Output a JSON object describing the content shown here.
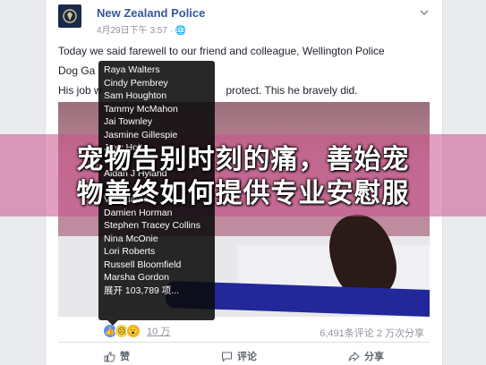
{
  "post": {
    "page_name": "New Zealand Police",
    "timestamp": "4月29日下午 3:57 · 🌐",
    "line1": "Today we said farewell to our friend and colleague, Wellington Police",
    "line2": "Dog Ga",
    "line3_start": "His job w",
    "line3_end": "protect. This he bravely did."
  },
  "tooltip": {
    "names": [
      "Raya Walters",
      "Cindy Pembrey",
      "Sam Houghton",
      "Tammy McMahon",
      "Jai Townley",
      "Jasmine Gillespie",
      "Jaxy Holt",
      "",
      "Aidan J Hyland",
      "",
      "Val Adams",
      "Damien Horman",
      "Stephen Tracey Collins",
      "Nina McOnie",
      "Lori Roberts",
      "Russell Bloomfield",
      "Marsha Gordon",
      "展开 103,789 项..."
    ]
  },
  "banner": {
    "line1": "宠物告别时刻的痛，善始宠",
    "line2": "物善终如何提供专业安慰服"
  },
  "footer": {
    "reaction_count": "10 万",
    "stats": "6,491条评论  2 万次分享"
  },
  "actions": {
    "like": "赞",
    "comment": "评论",
    "share": "分享"
  },
  "colors": {
    "link": "#365899",
    "banner": "#ca508c"
  }
}
